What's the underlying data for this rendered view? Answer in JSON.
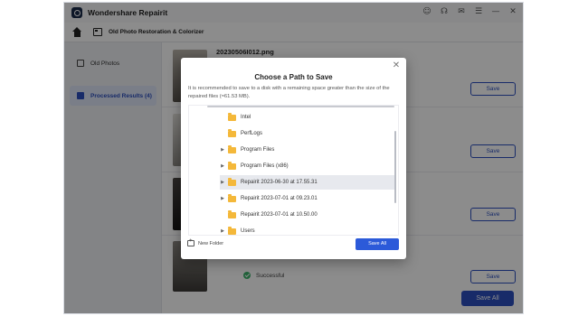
{
  "app": {
    "title": "Wondershare Repairit",
    "window_controls": [
      "person",
      "headset",
      "mail",
      "menu",
      "minimize",
      "close"
    ]
  },
  "toolbar": {
    "breadcrumb": "Old Photo Restoration & Colorizer"
  },
  "sidebar": {
    "items": [
      {
        "label": "Old Photos",
        "active": false
      },
      {
        "label": "Processed Results  (4)",
        "active": true
      }
    ]
  },
  "main": {
    "first_file_name": "20230506I012.png",
    "save_label": "Save",
    "status_successful": "Successful",
    "save_all_label": "Save All"
  },
  "dialog": {
    "title": "Choose a Path to Save",
    "description": "It is recommended to save to a disk with a remaining space greater than the size of the repaired files (≈61.53 MB).",
    "tree": [
      {
        "label": "Intel",
        "expandable": false,
        "selected": false
      },
      {
        "label": "PerfLogs",
        "expandable": false,
        "selected": false
      },
      {
        "label": "Program Files",
        "expandable": true,
        "selected": false
      },
      {
        "label": "Program Files (x86)",
        "expandable": true,
        "selected": false
      },
      {
        "label": "Repairit 2023-06-30 at 17.55.31",
        "expandable": true,
        "selected": true
      },
      {
        "label": "Repairit 2023-07-01 at 09.23.01",
        "expandable": true,
        "selected": false
      },
      {
        "label": "Repairit 2023-07-01 at 10.50.00",
        "expandable": false,
        "selected": false
      },
      {
        "label": "Users",
        "expandable": true,
        "selected": false
      }
    ],
    "new_folder_label": "New Folder",
    "save_all_label": "Save All",
    "close_icon": "close-icon"
  },
  "colors": {
    "accent": "#2c4fbf",
    "folder": "#f4b83a",
    "success": "#3db36b"
  }
}
